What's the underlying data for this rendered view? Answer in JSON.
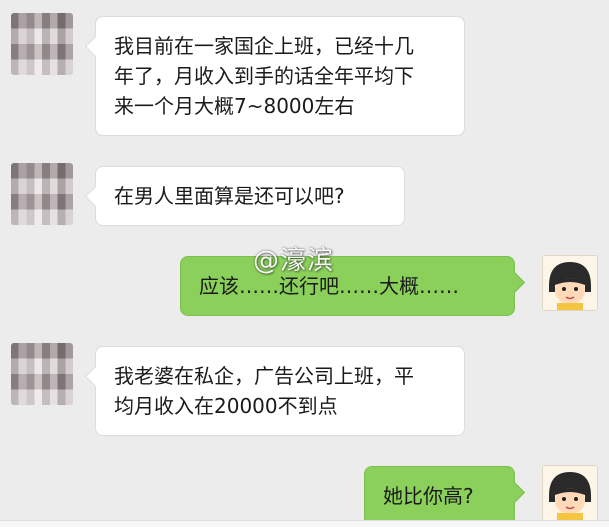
{
  "messages": [
    {
      "side": "left",
      "text": "我目前在一家国企上班，已经十几\n年了，月收入到手的话全年平均下\n来一个月大概7~8000左右"
    },
    {
      "side": "left",
      "text": "在男人里面算是还可以吧?"
    },
    {
      "side": "right",
      "text": "应该……还行吧……大概……"
    },
    {
      "side": "left",
      "text": "我老婆在私企，广告公司上班，平\n均月收入在20000不到点"
    },
    {
      "side": "right",
      "text": "她比你高?"
    }
  ],
  "watermark": "@濠滨",
  "avatars": {
    "left_icon": "pixelated-user-avatar",
    "right_icon": "cartoon-girl-avatar"
  },
  "colors": {
    "background": "#ececec",
    "incoming_bubble": "#ffffff",
    "outgoing_bubble": "#8ad05a"
  }
}
